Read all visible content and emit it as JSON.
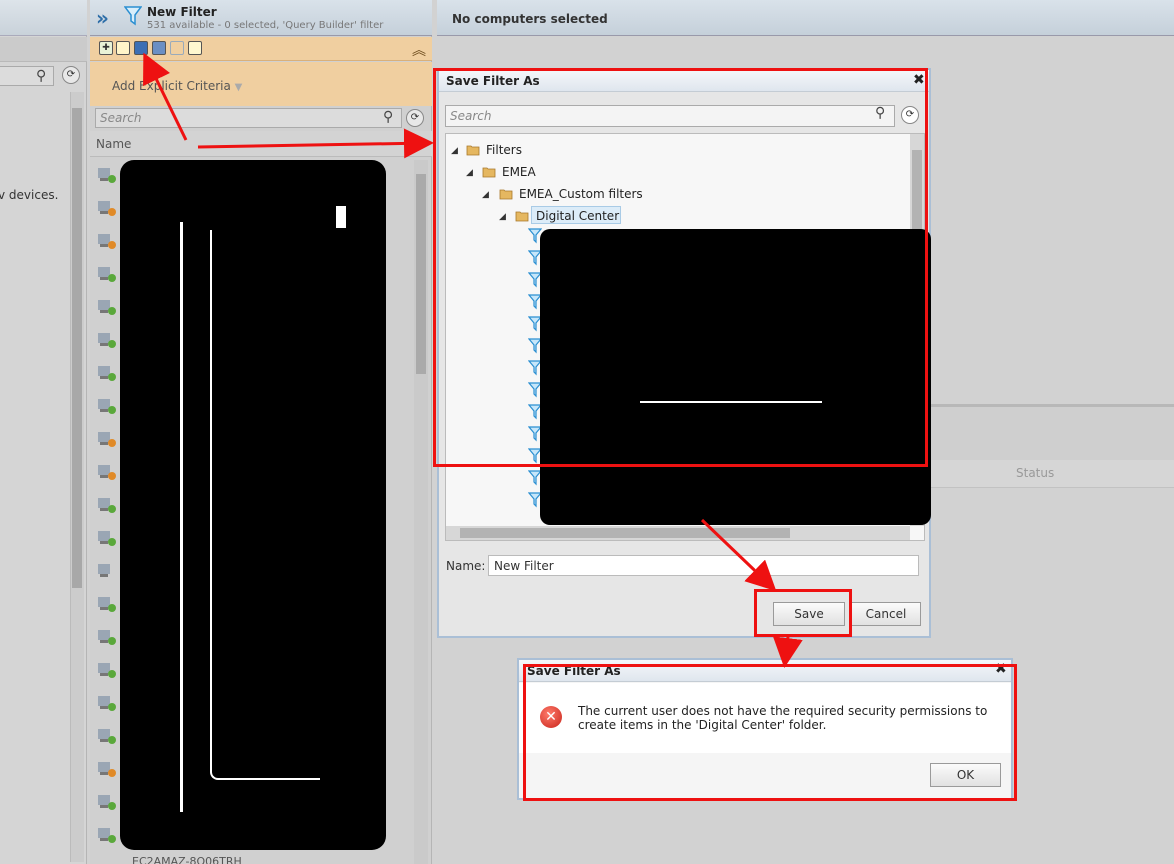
{
  "left_pane": {
    "partial_text": "v devices."
  },
  "filter_panel": {
    "title": "New Filter",
    "subtitle": "531 available - 0 selected, 'Query Builder' filter",
    "criteria_label": "Add Explicit Criteria",
    "search_placeholder": "Search",
    "column_name": "Name",
    "last_row_partial": "EC2AMAZ-8Q06TRH"
  },
  "right_pane": {
    "title": "No computers selected",
    "status_column": "Status"
  },
  "save_dialog": {
    "title": "Save Filter As",
    "close": "✖",
    "search_placeholder": "Search",
    "tree": [
      {
        "label": "Filters",
        "level": 0
      },
      {
        "label": "EMEA",
        "level": 1
      },
      {
        "label": "EMEA_Custom filters",
        "level": 2
      },
      {
        "label": "Digital Center",
        "level": 3,
        "selected": true
      }
    ],
    "name_label": "Name:",
    "name_value": "New Filter",
    "save_label": "Save",
    "cancel_label": "Cancel"
  },
  "error_dialog": {
    "title": "Save Filter As",
    "close": "✖",
    "message": "The current user does not have the required security permissions to create items in the 'Digital Center' folder.",
    "ok_label": "OK"
  },
  "colors": {
    "annotation_red": "#ee1111",
    "toolbar_orange": "#f0cfa0",
    "header_blue": "#c5d0da"
  }
}
